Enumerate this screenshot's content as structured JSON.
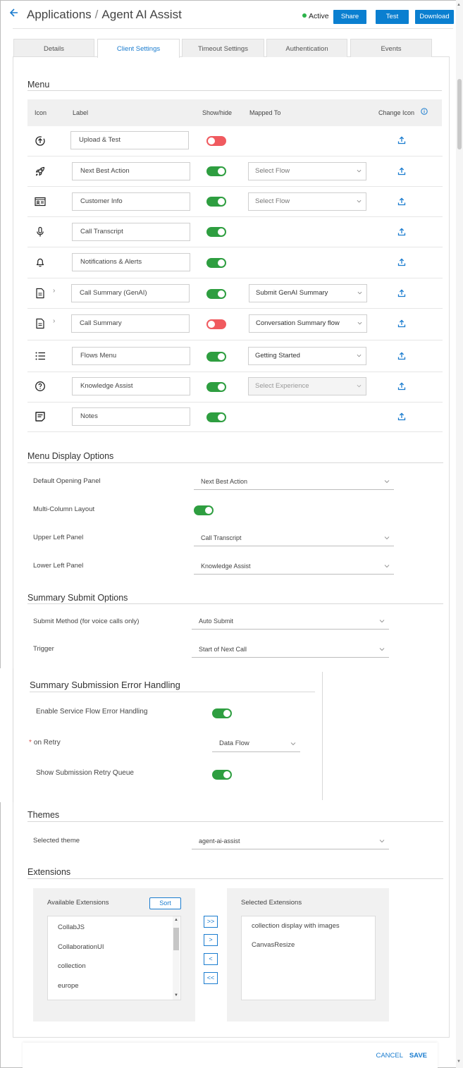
{
  "header": {
    "back_icon": "arrow-left-icon",
    "breadcrumb_root": "Applications",
    "breadcrumb_separator": "/",
    "title": "Agent AI Assist",
    "status": "Active",
    "status_color": "#2cb34a",
    "share_label": "Share",
    "test_label": "Test",
    "download_label": "Download"
  },
  "tabs": [
    {
      "label": "Details",
      "active": false
    },
    {
      "label": "Client Settings",
      "active": true
    },
    {
      "label": "Timeout Settings",
      "active": false
    },
    {
      "label": "Authentication",
      "active": false
    },
    {
      "label": "Events",
      "active": false
    }
  ],
  "menu": {
    "title": "Menu",
    "columns": {
      "icon": "Icon",
      "label": "Label",
      "show_hide": "Show/hide",
      "mapped_to": "Mapped To",
      "change_icon": "Change Icon"
    },
    "rows": [
      {
        "icon": "upload-circle-icon",
        "label": "Upload & Test",
        "enabled": false,
        "mapped_to": null,
        "expandable": false
      },
      {
        "icon": "rocket-icon",
        "label": "Next Best Action",
        "enabled": true,
        "mapped_to": "Select Flow",
        "mapped_placeholder": true,
        "expandable": false
      },
      {
        "icon": "id-card-icon",
        "label": "Customer Info",
        "enabled": true,
        "mapped_to": "Select Flow",
        "mapped_placeholder": true,
        "expandable": false
      },
      {
        "icon": "microphone-icon",
        "label": "Call Transcript",
        "enabled": true,
        "mapped_to": null,
        "expandable": false
      },
      {
        "icon": "bell-icon",
        "label": "Notifications & Alerts",
        "enabled": true,
        "mapped_to": null,
        "expandable": false
      },
      {
        "icon": "document-icon",
        "label": "Call Summary (GenAI)",
        "enabled": true,
        "mapped_to": "Submit GenAI Summary",
        "expandable": true
      },
      {
        "icon": "document-icon",
        "label": "Call Summary",
        "enabled": false,
        "mapped_to": "Conversation Summary flow",
        "expandable": true
      },
      {
        "icon": "list-icon",
        "label": "Flows Menu",
        "enabled": true,
        "mapped_to": "Getting Started",
        "expandable": false
      },
      {
        "icon": "question-circle-icon",
        "label": "Knowledge Assist",
        "enabled": true,
        "mapped_to": "Select Experience",
        "mapped_disabled": true,
        "expandable": false
      },
      {
        "icon": "note-icon",
        "label": "Notes",
        "enabled": true,
        "mapped_to": null,
        "expandable": false
      }
    ]
  },
  "display_options": {
    "title": "Menu Display Options",
    "default_panel_label": "Default Opening Panel",
    "default_panel_value": "Next Best Action",
    "multi_column_label": "Multi-Column Layout",
    "multi_column_enabled": true,
    "upper_left_label": "Upper Left Panel",
    "upper_left_value": "Call Transcript",
    "lower_left_label": "Lower Left Panel",
    "lower_left_value": "Knowledge Assist"
  },
  "summary_submit": {
    "title": "Summary Submit Options",
    "method_label": "Submit Method (for voice calls only)",
    "method_value": "Auto Submit",
    "trigger_label": "Trigger",
    "trigger_value": "Start of Next Call"
  },
  "error_handling": {
    "title": "Summary Submission Error Handling",
    "enable_label": "Enable Service Flow Error Handling",
    "enable_value": true,
    "retry_required_mark": "*",
    "retry_label": "on Retry",
    "retry_value": "Data Flow",
    "queue_label": "Show Submission Retry Queue",
    "queue_value": true
  },
  "themes": {
    "title": "Themes",
    "selected_label": "Selected theme",
    "selected_value": "agent-ai-assist"
  },
  "extensions": {
    "title": "Extensions",
    "available_title": "Available Extensions",
    "sort_label": "Sort",
    "available": [
      "CollabJS",
      "CollaborationUI",
      "collection",
      "europe"
    ],
    "selected_title": "Selected Extensions",
    "selected": [
      "collection display with images",
      "CanvasResize"
    ],
    "move_all_right": ">>",
    "move_right": ">",
    "move_left": "<",
    "move_all_left": "<<"
  },
  "footer": {
    "cancel_label": "CANCEL",
    "save_label": "SAVE"
  },
  "colors": {
    "accent": "#0a7fd0",
    "toggle_on": "#2e9e40",
    "toggle_off": "#f05a5f"
  }
}
